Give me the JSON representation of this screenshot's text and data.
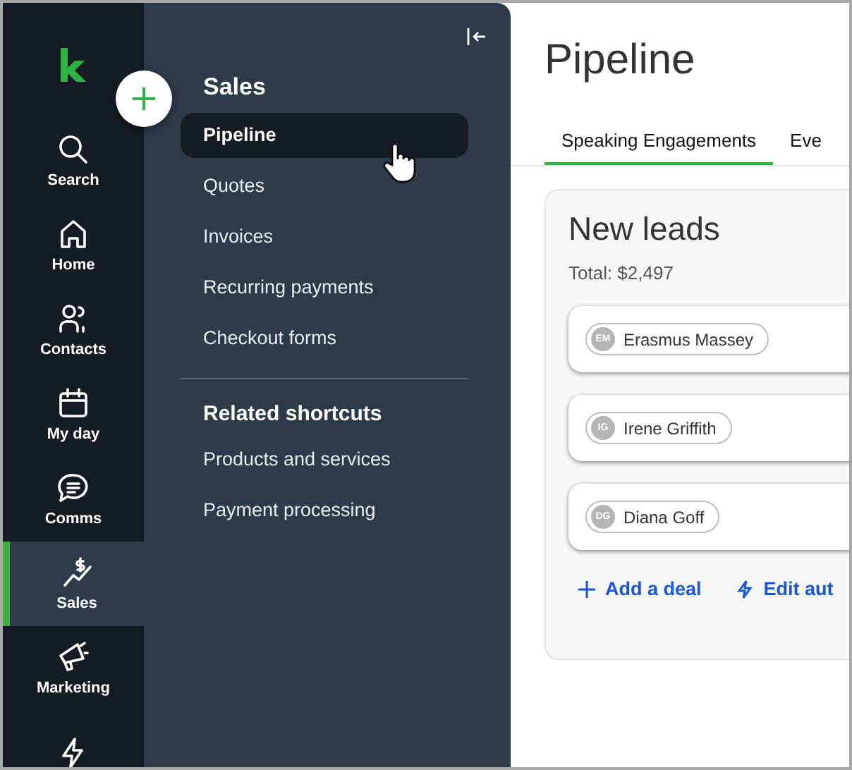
{
  "rail": {
    "items": [
      {
        "label": "Search",
        "kind": "search",
        "selected": false
      },
      {
        "label": "Home",
        "kind": "home",
        "selected": false
      },
      {
        "label": "Contacts",
        "kind": "contacts",
        "selected": false
      },
      {
        "label": "My day",
        "kind": "calendar",
        "selected": false
      },
      {
        "label": "Comms",
        "kind": "chat",
        "selected": false
      },
      {
        "label": "Sales",
        "kind": "sales",
        "selected": true
      },
      {
        "label": "Marketing",
        "kind": "megaphone",
        "selected": false
      },
      {
        "kind": "bolt",
        "selected": false
      }
    ]
  },
  "nav": {
    "title": "Sales",
    "items": [
      {
        "label": "Pipeline",
        "selected": true
      },
      {
        "label": "Quotes",
        "selected": false
      },
      {
        "label": "Invoices",
        "selected": false
      },
      {
        "label": "Recurring payments",
        "selected": false
      },
      {
        "label": "Checkout forms",
        "selected": false
      }
    ],
    "shortcuts_title": "Related shortcuts",
    "shortcuts": [
      "Products and services",
      "Payment processing"
    ]
  },
  "page": {
    "title": "Pipeline",
    "tabs": [
      {
        "label": "Speaking Engagements",
        "selected": true
      },
      {
        "label": "Eve",
        "selected": false
      }
    ],
    "stage": {
      "title": "New leads",
      "total": "Total: $2,497",
      "deals": [
        {
          "initials": "EM",
          "name": "Erasmus Massey"
        },
        {
          "initials": "IG",
          "name": "Irene Griffith"
        },
        {
          "initials": "DG",
          "name": "Diana Goff"
        }
      ],
      "actions": [
        {
          "label": "Add a deal",
          "kind": "add"
        },
        {
          "label": "Edit aut",
          "kind": "automation"
        }
      ]
    }
  }
}
